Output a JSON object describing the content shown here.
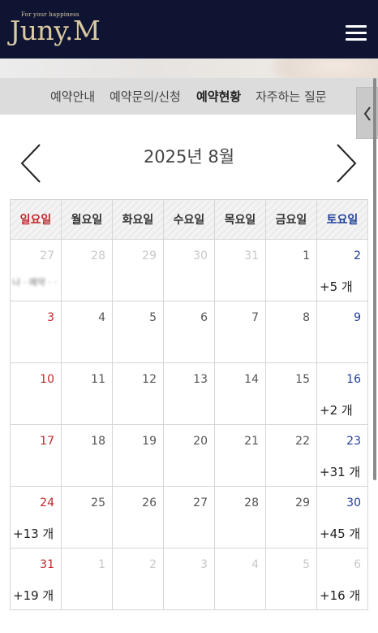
{
  "header": {
    "logo_tagline": "For your happiness",
    "logo_text": "Juny.M",
    "menu_icon": "hamburger-menu-icon",
    "background_color": "#0f1433",
    "logo_color": "#d8c9a0"
  },
  "banner": {
    "partial_text": "· · · · ·"
  },
  "tabs": [
    {
      "label": "예약안내",
      "active": false
    },
    {
      "label": "예약문의/신청",
      "active": false
    },
    {
      "label": "예약현황",
      "active": true
    },
    {
      "label": "자주하는 질문",
      "active": false
    }
  ],
  "side_handle_icon": "chevron-left-icon",
  "calendar": {
    "title": "2025년 8월",
    "prev_icon": "chevron-left-icon",
    "next_icon": "chevron-right-icon",
    "weekdays": [
      "일요일",
      "월요일",
      "화요일",
      "수요일",
      "목요일",
      "금요일",
      "토요일"
    ],
    "weeks": [
      [
        {
          "day": "27",
          "other": true,
          "blurred": "나 · 예약 · ·"
        },
        {
          "day": "28",
          "other": true
        },
        {
          "day": "29",
          "other": true
        },
        {
          "day": "30",
          "other": true
        },
        {
          "day": "31",
          "other": true
        },
        {
          "day": "1"
        },
        {
          "day": "2",
          "count": "+5 개"
        }
      ],
      [
        {
          "day": "3"
        },
        {
          "day": "4"
        },
        {
          "day": "5"
        },
        {
          "day": "6"
        },
        {
          "day": "7"
        },
        {
          "day": "8"
        },
        {
          "day": "9"
        }
      ],
      [
        {
          "day": "10"
        },
        {
          "day": "11"
        },
        {
          "day": "12"
        },
        {
          "day": "13"
        },
        {
          "day": "14"
        },
        {
          "day": "15"
        },
        {
          "day": "16",
          "count": "+2 개"
        }
      ],
      [
        {
          "day": "17"
        },
        {
          "day": "18"
        },
        {
          "day": "19"
        },
        {
          "day": "20"
        },
        {
          "day": "21"
        },
        {
          "day": "22"
        },
        {
          "day": "23",
          "count": "+31 개"
        }
      ],
      [
        {
          "day": "24",
          "count": "+13 개"
        },
        {
          "day": "25"
        },
        {
          "day": "26"
        },
        {
          "day": "27"
        },
        {
          "day": "28"
        },
        {
          "day": "29"
        },
        {
          "day": "30",
          "count": "+45 개"
        }
      ],
      [
        {
          "day": "31",
          "count": "+19 개"
        },
        {
          "day": "1",
          "other": true
        },
        {
          "day": "2",
          "other": true
        },
        {
          "day": "3",
          "other": true
        },
        {
          "day": "4",
          "other": true
        },
        {
          "day": "5",
          "other": true
        },
        {
          "day": "6",
          "other": true,
          "count": "+16 개"
        }
      ]
    ]
  }
}
